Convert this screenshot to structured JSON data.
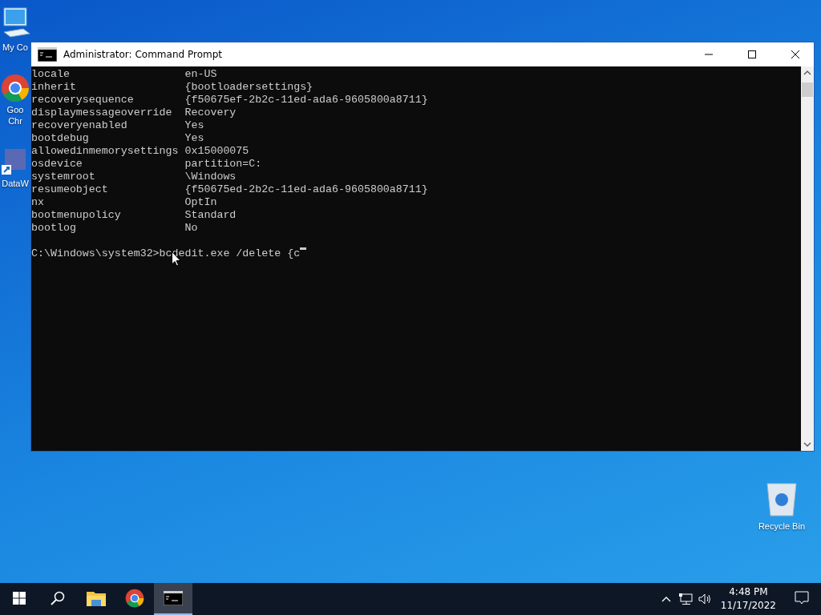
{
  "desktop": {
    "icons": [
      {
        "kind": "computer",
        "label": "My Co"
      },
      {
        "kind": "chrome",
        "label": "Goo Chr"
      },
      {
        "kind": "app",
        "label": "DataW"
      }
    ],
    "recycle_bin": {
      "label": "Recycle Bin"
    }
  },
  "window": {
    "title": "Administrator: Command Prompt",
    "console": {
      "entries": [
        {
          "name": "locale",
          "value": "en-US"
        },
        {
          "name": "inherit",
          "value": "{bootloadersettings}"
        },
        {
          "name": "recoverysequence",
          "value": "{f50675ef-2b2c-11ed-ada6-9605800a8711}"
        },
        {
          "name": "displaymessageoverride",
          "value": "Recovery"
        },
        {
          "name": "recoveryenabled",
          "value": "Yes"
        },
        {
          "name": "bootdebug",
          "value": "Yes"
        },
        {
          "name": "allowedinmemorysettings",
          "value": "0x15000075"
        },
        {
          "name": "osdevice",
          "value": "partition=C:"
        },
        {
          "name": "systemroot",
          "value": "\\Windows"
        },
        {
          "name": "resumeobject",
          "value": "{f50675ed-2b2c-11ed-ada6-9605800a8711}"
        },
        {
          "name": "nx",
          "value": "OptIn"
        },
        {
          "name": "bootmenupolicy",
          "value": "Standard"
        },
        {
          "name": "bootlog",
          "value": "No"
        }
      ],
      "prompt": "C:\\Windows\\system32>bcdedit.exe /delete {c"
    }
  },
  "taskbar": {
    "apps": [
      {
        "kind": "explorer",
        "selected": false
      },
      {
        "kind": "chrome",
        "selected": false
      },
      {
        "kind": "cmd",
        "selected": true
      }
    ],
    "clock": {
      "time": "4:48 PM",
      "date": "11/17/2022"
    }
  }
}
